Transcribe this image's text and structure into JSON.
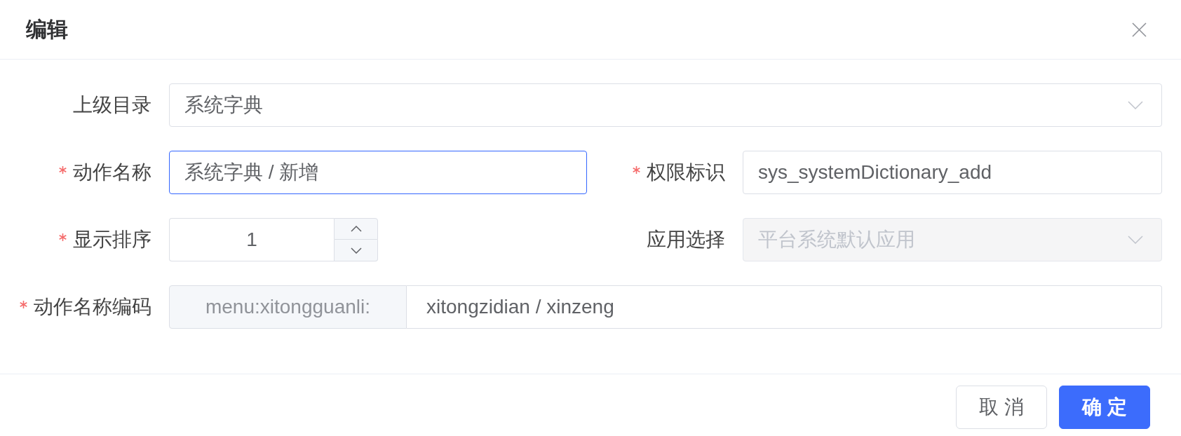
{
  "dialog": {
    "title": "编辑"
  },
  "form": {
    "rows": [
      [
        {
          "label": "上级目录",
          "required": false,
          "kind": "select",
          "value": "系统字典",
          "disabled": false
        }
      ],
      [
        {
          "label": "动作名称",
          "required": true,
          "kind": "text",
          "value": "系统字典 / 新增",
          "focused": true
        },
        {
          "label": "权限标识",
          "required": true,
          "kind": "text",
          "value": "sys_systemDictionary_add",
          "focused": false
        }
      ],
      [
        {
          "label": "显示排序",
          "required": true,
          "kind": "number",
          "value": "1"
        },
        {
          "label": "应用选择",
          "required": false,
          "kind": "select",
          "value": "平台系统默认应用",
          "disabled": true
        }
      ],
      [
        {
          "label": "动作名称编码",
          "required": true,
          "kind": "prefixed",
          "prefix": "menu:xitongguanli:",
          "value": "xitongzidian / xinzeng"
        }
      ]
    ]
  },
  "footer": {
    "buttons": [
      {
        "label": "取 消",
        "kind": "default"
      },
      {
        "label": "确 定",
        "kind": "primary"
      }
    ]
  }
}
